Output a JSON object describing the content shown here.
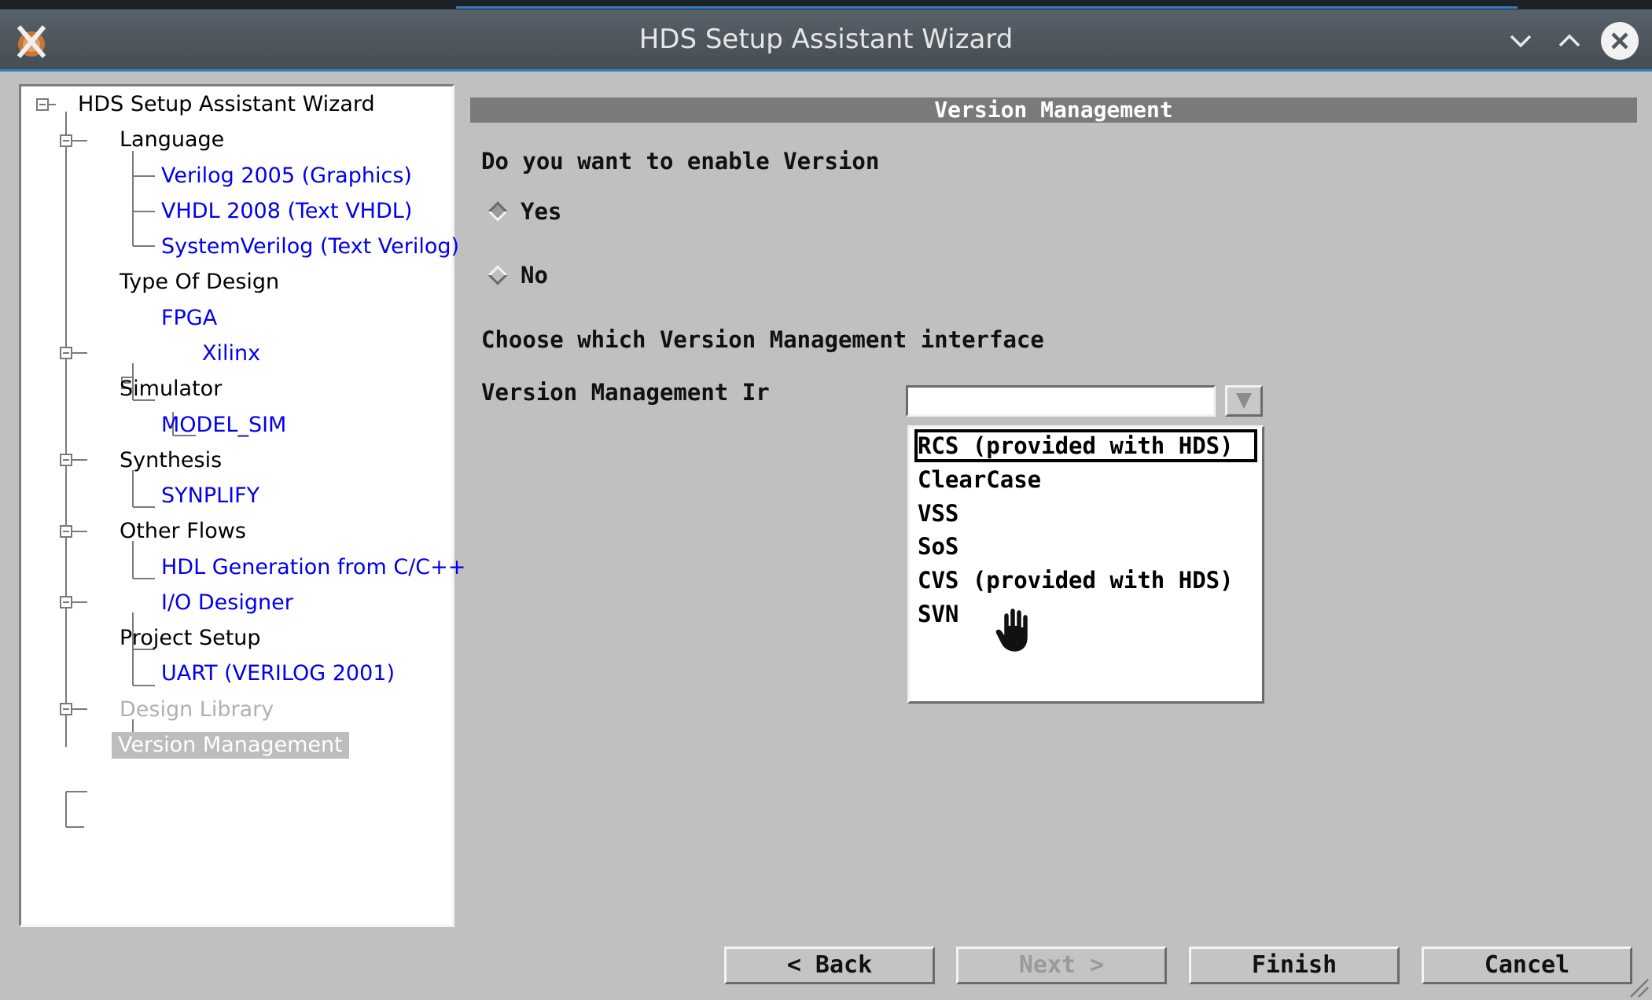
{
  "window": {
    "title": "HDS Setup Assistant Wizard",
    "controls": [
      "minimize-icon",
      "maximize-icon",
      "close-icon"
    ]
  },
  "tree": {
    "root": "HDS Setup Assistant Wizard",
    "items": [
      {
        "label": "Language",
        "type": "category"
      },
      {
        "label": "Verilog 2005 (Graphics)",
        "type": "link"
      },
      {
        "label": "VHDL 2008 (Text VHDL)",
        "type": "link"
      },
      {
        "label": "SystemVerilog (Text Verilog)",
        "type": "link"
      },
      {
        "label": "Type Of Design",
        "type": "category"
      },
      {
        "label": "FPGA",
        "type": "link"
      },
      {
        "label": "Xilinx",
        "type": "link"
      },
      {
        "label": "Simulator",
        "type": "category"
      },
      {
        "label": "MODEL_SIM",
        "type": "link"
      },
      {
        "label": "Synthesis",
        "type": "category"
      },
      {
        "label": "SYNPLIFY",
        "type": "link"
      },
      {
        "label": "Other Flows",
        "type": "category"
      },
      {
        "label": "HDL Generation from C/C++",
        "type": "link"
      },
      {
        "label": "I/O Designer",
        "type": "link"
      },
      {
        "label": "Project Setup",
        "type": "category"
      },
      {
        "label": "UART (VERILOG 2001)",
        "type": "link"
      },
      {
        "label": "Design Library",
        "type": "disabled"
      },
      {
        "label": "Version Management",
        "type": "selected"
      }
    ]
  },
  "page": {
    "header": "Version Management",
    "question": "Do you want to enable Version",
    "radio_yes": "Yes",
    "radio_no": "No",
    "selected_radio": "Yes",
    "choose_label": "Choose which Version Management interface",
    "field_label": "Version Management Ir",
    "combo_value": "",
    "dropdown_options": [
      "RCS (provided with HDS)",
      "ClearCase",
      "VSS",
      "SoS",
      "CVS (provided with HDS)",
      "SVN"
    ],
    "focused_option": "RCS (provided with HDS)"
  },
  "buttons": {
    "back": "< Back",
    "next": "Next >",
    "finish": "Finish",
    "cancel": "Cancel"
  },
  "colors": {
    "titlebar": "#4f5860",
    "accent": "#2e7fc4",
    "link": "#0000ee",
    "background": "#c0c0c0"
  }
}
